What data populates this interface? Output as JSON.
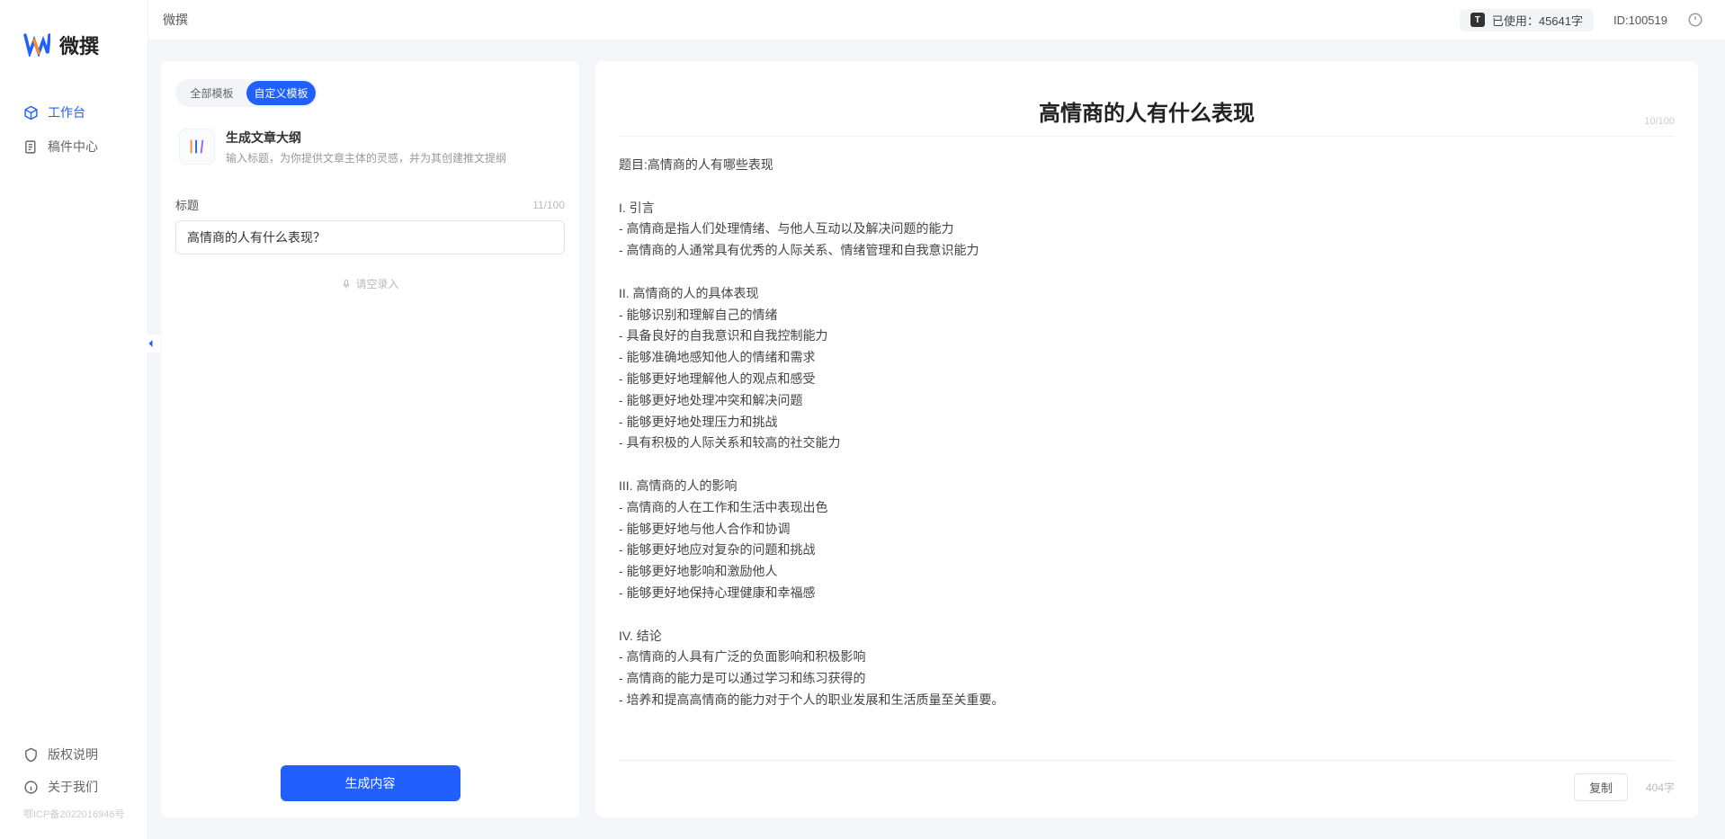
{
  "app": {
    "name": "微撰",
    "logo_letter": "W"
  },
  "header": {
    "title": "微撰",
    "usage_label": "已使用：",
    "usage_value": "45641字",
    "user_id_label": "ID:100519"
  },
  "sidebar": {
    "items": [
      {
        "label": "工作台",
        "icon": "cube"
      },
      {
        "label": "稿件中心",
        "icon": "doc"
      }
    ],
    "bottom": [
      {
        "label": "版权说明",
        "icon": "shield"
      },
      {
        "label": "关于我们",
        "icon": "info"
      }
    ],
    "icp": "鄂ICP备2022016946号"
  },
  "tabs": {
    "all": "全部模板",
    "custom": "自定义模板"
  },
  "template": {
    "name": "生成文章大纲",
    "desc": "输入标题，为你提供文章主体的灵感，并为其创建推文提纲"
  },
  "form": {
    "title_label": "标题",
    "title_counter": "11/100",
    "title_value": "高情商的人有什么表现？",
    "voice_label": "请空录入",
    "generate_label": "生成内容"
  },
  "output": {
    "title": "高情商的人有什么表现",
    "title_counter": "10/100",
    "word_count": "404字",
    "copy_label": "复制",
    "body": "题目:高情商的人有哪些表现\n\nI. 引言\n- 高情商是指人们处理情绪、与他人互动以及解决问题的能力\n- 高情商的人通常具有优秀的人际关系、情绪管理和自我意识能力\n\nII. 高情商的人的具体表现\n- 能够识别和理解自己的情绪\n- 具备良好的自我意识和自我控制能力\n- 能够准确地感知他人的情绪和需求\n- 能够更好地理解他人的观点和感受\n- 能够更好地处理冲突和解决问题\n- 能够更好地处理压力和挑战\n- 具有积极的人际关系和较高的社交能力\n\nIII. 高情商的人的影响\n- 高情商的人在工作和生活中表现出色\n- 能够更好地与他人合作和协调\n- 能够更好地应对复杂的问题和挑战\n- 能够更好地影响和激励他人\n- 能够更好地保持心理健康和幸福感\n\nIV. 结论\n- 高情商的人具有广泛的负面影响和积极影响\n- 高情商的能力是可以通过学习和练习获得的\n- 培养和提高高情商的能力对于个人的职业发展和生活质量至关重要。"
  }
}
